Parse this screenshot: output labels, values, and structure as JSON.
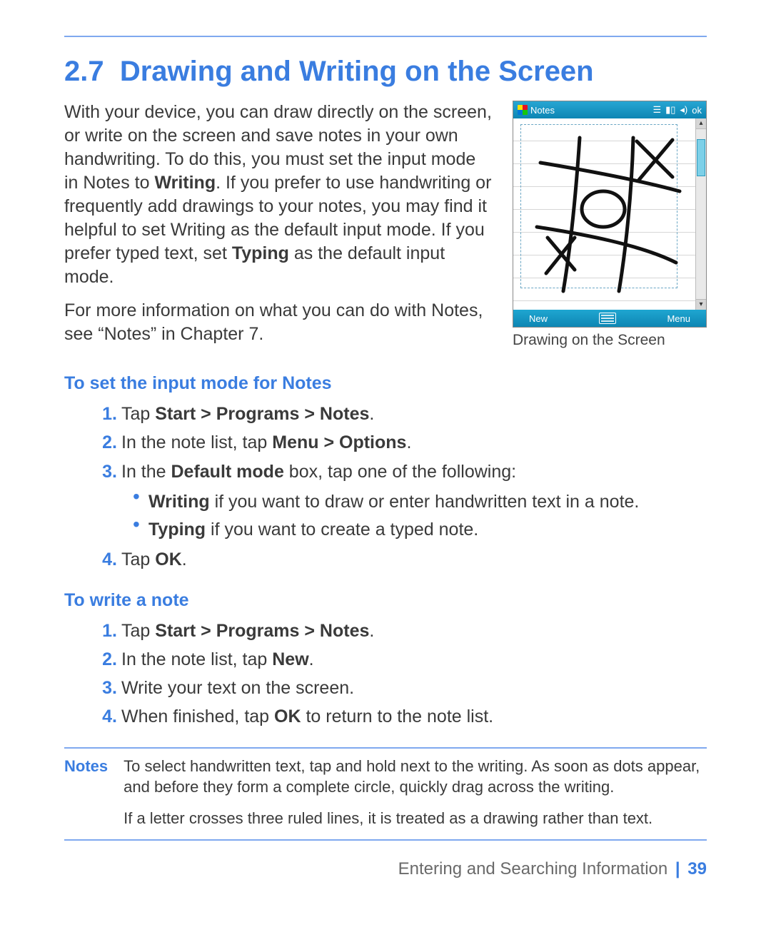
{
  "section": {
    "number": "2.7",
    "title": "Drawing and Writing on the Screen"
  },
  "intro": {
    "p1_a": "With your device, you can draw directly on the screen, or write on the screen and save notes in your own handwriting. To do this, you must set the input mode in Notes to ",
    "p1_b_bold": "Writing",
    "p1_c": ". If you prefer to use handwriting or frequently add drawings to your notes, you may find it helpful to set Writing as the default input mode. If you prefer typed text, set ",
    "p1_d_bold": "Typing",
    "p1_e": " as the default input mode.",
    "p2": "For more information on what you can do with Notes, see “Notes” in Chapter 7."
  },
  "figure": {
    "header_app": "Notes",
    "bottom_left": "New",
    "bottom_right": "Menu",
    "status_ok": "ok",
    "caption": "Drawing on the Screen"
  },
  "procedures": [
    {
      "heading": "To set the input mode for Notes",
      "steps": [
        {
          "pre": "Tap ",
          "bold": "Start > Programs > Notes",
          "post": "."
        },
        {
          "pre": "In the note list, tap ",
          "bold": "Menu > Options",
          "post": "."
        },
        {
          "pre": "In the ",
          "bold": "Default mode",
          "post": " box, tap one of the following:",
          "sub": [
            {
              "bold": "Writing",
              "post": " if you want to draw or enter handwritten text in a note."
            },
            {
              "bold": "Typing",
              "post": " if you want to create a typed note."
            }
          ]
        },
        {
          "pre": "Tap ",
          "bold": "OK",
          "post": "."
        }
      ]
    },
    {
      "heading": "To write a note",
      "steps": [
        {
          "pre": "Tap ",
          "bold": "Start > Programs > Notes",
          "post": "."
        },
        {
          "pre": "In the note list, tap ",
          "bold": "New",
          "post": "."
        },
        {
          "pre": "Write your text on the screen."
        },
        {
          "pre": "When finished, tap ",
          "bold": "OK",
          "post": " to return to the note list."
        }
      ]
    }
  ],
  "notes": {
    "label": "Notes",
    "paragraphs": [
      "To select handwritten text, tap and hold next to the writing. As soon as dots appear, and before they form a complete circle, quickly drag across the writing.",
      "If a letter crosses three ruled lines, it is treated as a drawing rather than text."
    ]
  },
  "footer": {
    "chapter": "Entering and Searching Information",
    "page": "39"
  }
}
